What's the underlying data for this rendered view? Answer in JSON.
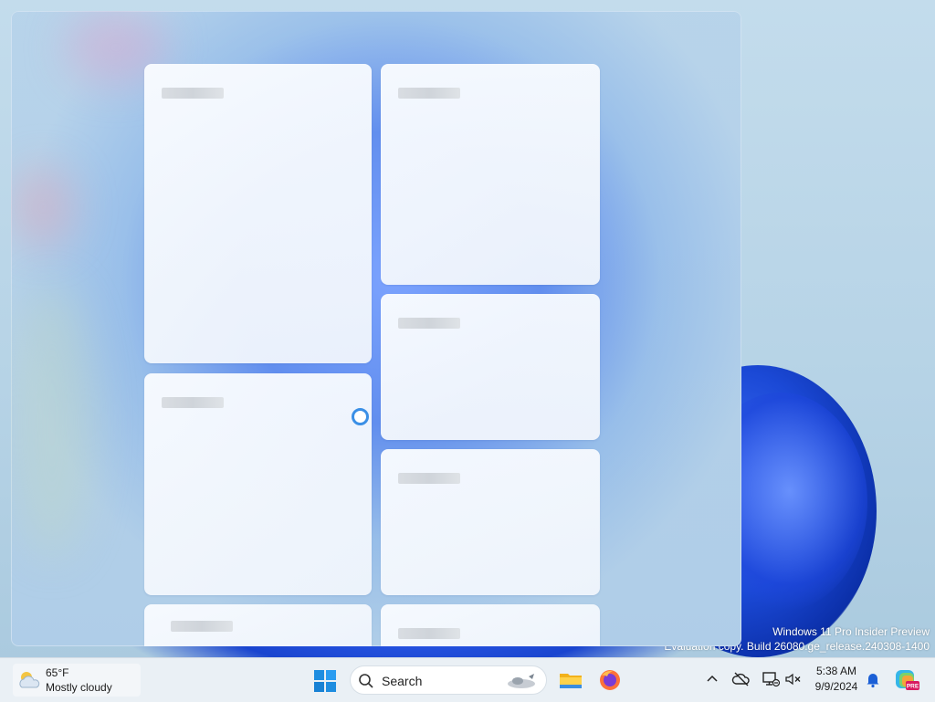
{
  "desktop": {
    "watermark_line1": "Windows 11 Pro Insider Preview",
    "watermark_line2": "Evaluation copy. Build 26080.ge_release.240308-1400"
  },
  "widgets_panel": {
    "cards": [
      "card-1",
      "card-2",
      "card-3",
      "card-4",
      "card-5",
      "card-6",
      "card-7"
    ],
    "loading": true
  },
  "taskbar": {
    "weather": {
      "temperature": "65°F",
      "condition": "Mostly cloudy"
    },
    "search": {
      "placeholder": "Search"
    },
    "pinned_apps": [
      "file-explorer",
      "firefox"
    ],
    "clock": {
      "time": "5:38 AM",
      "date": "9/9/2024"
    },
    "copilot_badge": "PRE"
  }
}
